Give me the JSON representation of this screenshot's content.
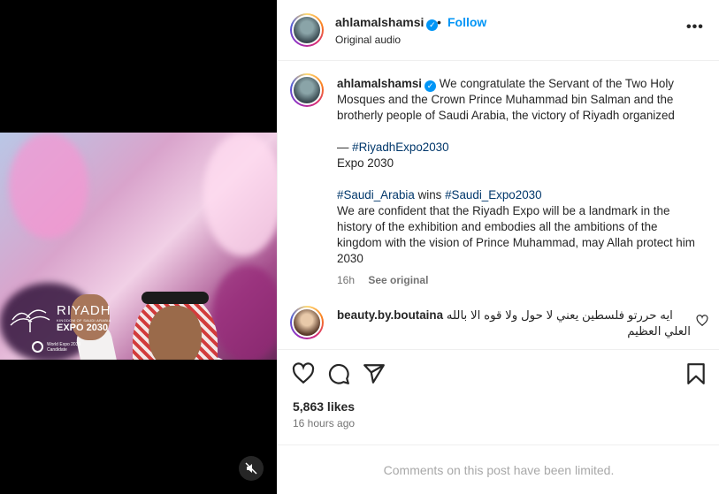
{
  "header": {
    "username": "ahlamalshamsi",
    "separator": "•",
    "follow_label": "Follow",
    "audio_label": "Original audio",
    "more_label": "•••"
  },
  "media": {
    "logo": {
      "title": "RIYADH",
      "subtitle": "KINGDOM OF SAUDI ARABIA",
      "expo": "EXPO 2030",
      "world_expo": "World Expo 2030",
      "candidate": "Candidate"
    },
    "mute_icon": "speaker-muted-icon"
  },
  "caption": {
    "username": "ahlamalshamsi",
    "line1": "We congratulate the Servant of the Two Holy Mosques and the Crown Prince Muhammad bin Salman and the brotherly people of Saudi Arabia, the victory of Riyadh organized",
    "dash": "— ",
    "hashtag1": "#RiyadhExpo2030",
    "expo_line": "Expo 2030",
    "hashtag2": "#Saudi_Arabia",
    "wins": " wins ",
    "hashtag3": "#Saudi_Expo2030",
    "line3": "We are confident that the Riyadh Expo will be a landmark in the history of the exhibition and embodies all the ambitions of the kingdom with the vision of Prince Muhammad, may Allah protect him 2030",
    "time": "16h",
    "see_original": "See original"
  },
  "comment": {
    "username": "beauty.by.boutaina",
    "text_line1": "ايه حررتو فلسطين يعني لا حول ولا قوه الا بالله",
    "text_line2": "العلي العظيم"
  },
  "actions": {
    "like_icon": "heart-icon",
    "comment_icon": "comment-icon",
    "share_icon": "send-icon",
    "save_icon": "bookmark-icon"
  },
  "stats": {
    "likes": "5,863 likes",
    "posted": "16 hours ago"
  },
  "footer": {
    "limited_text": "Comments on this post have been limited."
  },
  "colors": {
    "accent": "#0095f6",
    "hashtag": "#00376b",
    "muted_text": "#737373",
    "border": "#efefef"
  }
}
